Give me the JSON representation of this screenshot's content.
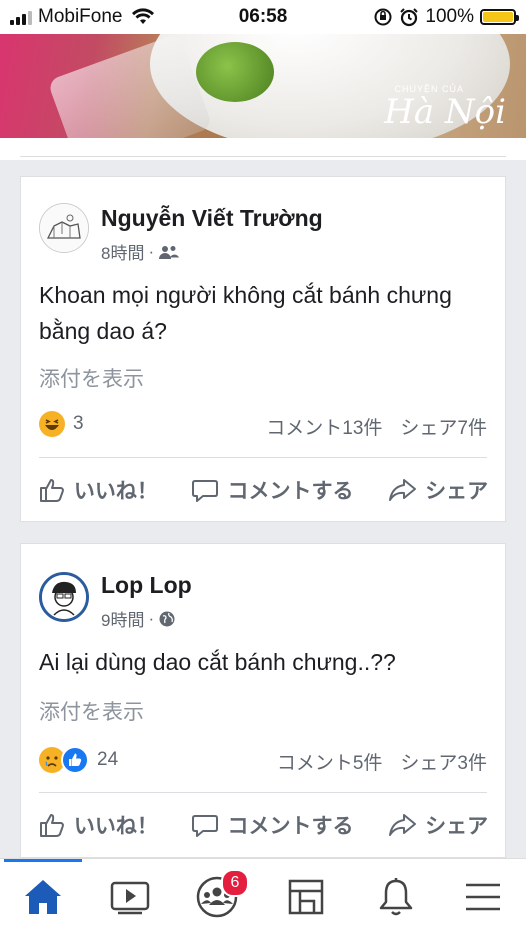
{
  "status_bar": {
    "carrier": "MobiFone",
    "time": "06:58",
    "battery": "100%",
    "battery_level": 1.0
  },
  "banner": {
    "watermark_small": "CHUYỆN CỦA",
    "watermark": "Hà Nội"
  },
  "posts": [
    {
      "author": "Nguyễn Viết Trường",
      "time": "8時間",
      "audience_icon": "friends-icon",
      "text": "Khoan mọi người không cắt bánh chưng bằng dao á?",
      "attachment_label": "添付を表示",
      "reaction_count": "3",
      "comments": "コメント13件",
      "shares": "シェア7件",
      "actions": {
        "like": "いいね！",
        "comment": "コメントする",
        "share": "シェア"
      }
    },
    {
      "author": "Lop Lop",
      "time": "9時間",
      "audience_icon": "globe-icon",
      "text": "Ai lại dùng dao cắt bánh chưng..??",
      "attachment_label": "添付を表示",
      "reaction_count": "24",
      "comments": "コメント5件",
      "shares": "シェア3件",
      "actions": {
        "like": "いいね！",
        "comment": "コメントする",
        "share": "シェア"
      }
    }
  ],
  "bottom_nav": {
    "items": [
      "home-icon",
      "watch-icon",
      "groups-icon",
      "marketplace-icon",
      "notifications-icon",
      "menu-icon"
    ],
    "groups_badge": "6",
    "accent": "#1877f2"
  }
}
